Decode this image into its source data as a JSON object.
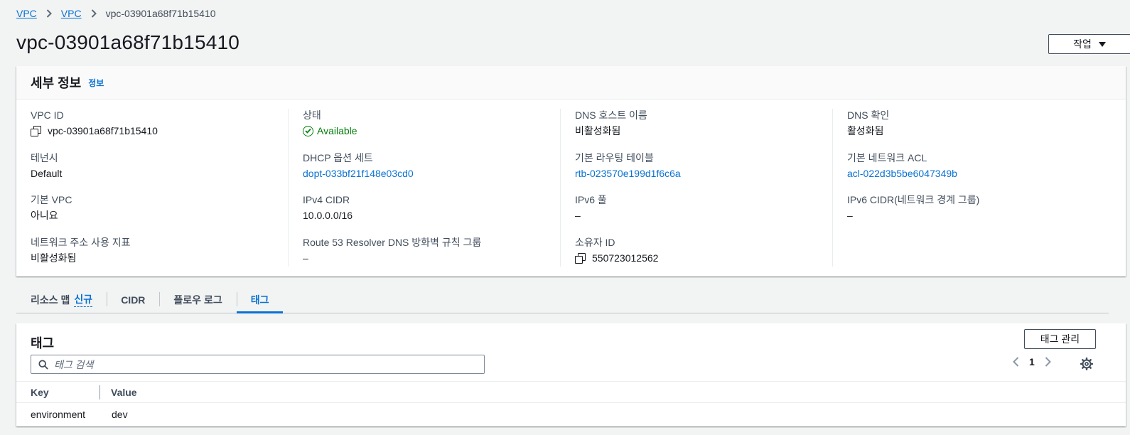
{
  "breadcrumb": {
    "items": [
      "VPC",
      "VPC"
    ],
    "current": "vpc-03901a68f71b15410"
  },
  "page": {
    "title": "vpc-03901a68f71b15410",
    "actions_label": "작업"
  },
  "details": {
    "title": "세부 정보",
    "info_label": "정보",
    "col1": [
      {
        "label": "VPC ID",
        "value": "vpc-03901a68f71b15410"
      },
      {
        "label": "테넌시",
        "value": "Default"
      },
      {
        "label": "기본 VPC",
        "value": "아니요"
      },
      {
        "label": "네트워크 주소 사용 지표",
        "value": "비활성화됨"
      }
    ],
    "col2": [
      {
        "label": "상태",
        "value": "Available"
      },
      {
        "label": "DHCP 옵션 세트",
        "value": "dopt-033bf21f148e03cd0"
      },
      {
        "label": "IPv4 CIDR",
        "value": "10.0.0.0/16"
      },
      {
        "label": "Route 53 Resolver DNS 방화벽 규칙 그룹",
        "value": "–"
      }
    ],
    "col3": [
      {
        "label": "DNS 호스트 이름",
        "value": "비활성화됨"
      },
      {
        "label": "기본 라우팅 테이블",
        "value": "rtb-023570e199d1f6c6a"
      },
      {
        "label": "IPv6 풀",
        "value": "–"
      },
      {
        "label": "소유자 ID",
        "value": "550723012562"
      }
    ],
    "col4": [
      {
        "label": "DNS 확인",
        "value": "활성화됨"
      },
      {
        "label": "기본 네트워크 ACL",
        "value": "acl-022d3b5be6047349b"
      },
      {
        "label": "IPv6 CIDR(네트워크 경계 그룹)",
        "value": "–"
      }
    ]
  },
  "tabs": [
    {
      "label": "리소스 맵",
      "badge": "신규"
    },
    {
      "label": "CIDR"
    },
    {
      "label": "플로우 로그"
    },
    {
      "label": "태그",
      "active": true
    }
  ],
  "tags": {
    "title": "태그",
    "manage_label": "태그 관리",
    "search_placeholder": "태그 검색",
    "page": "1",
    "columns": {
      "key": "Key",
      "value": "Value"
    },
    "rows": [
      {
        "key": "environment",
        "value": "dev"
      }
    ]
  },
  "colors": {
    "link": "#0972d3",
    "success": "#037f0c",
    "background": "#f2f3f3"
  },
  "icons": [
    "chevron-right-icon",
    "caret-down-icon",
    "copy-icon",
    "status-check-icon",
    "search-icon",
    "chevron-left-icon",
    "settings-gear-icon"
  ]
}
